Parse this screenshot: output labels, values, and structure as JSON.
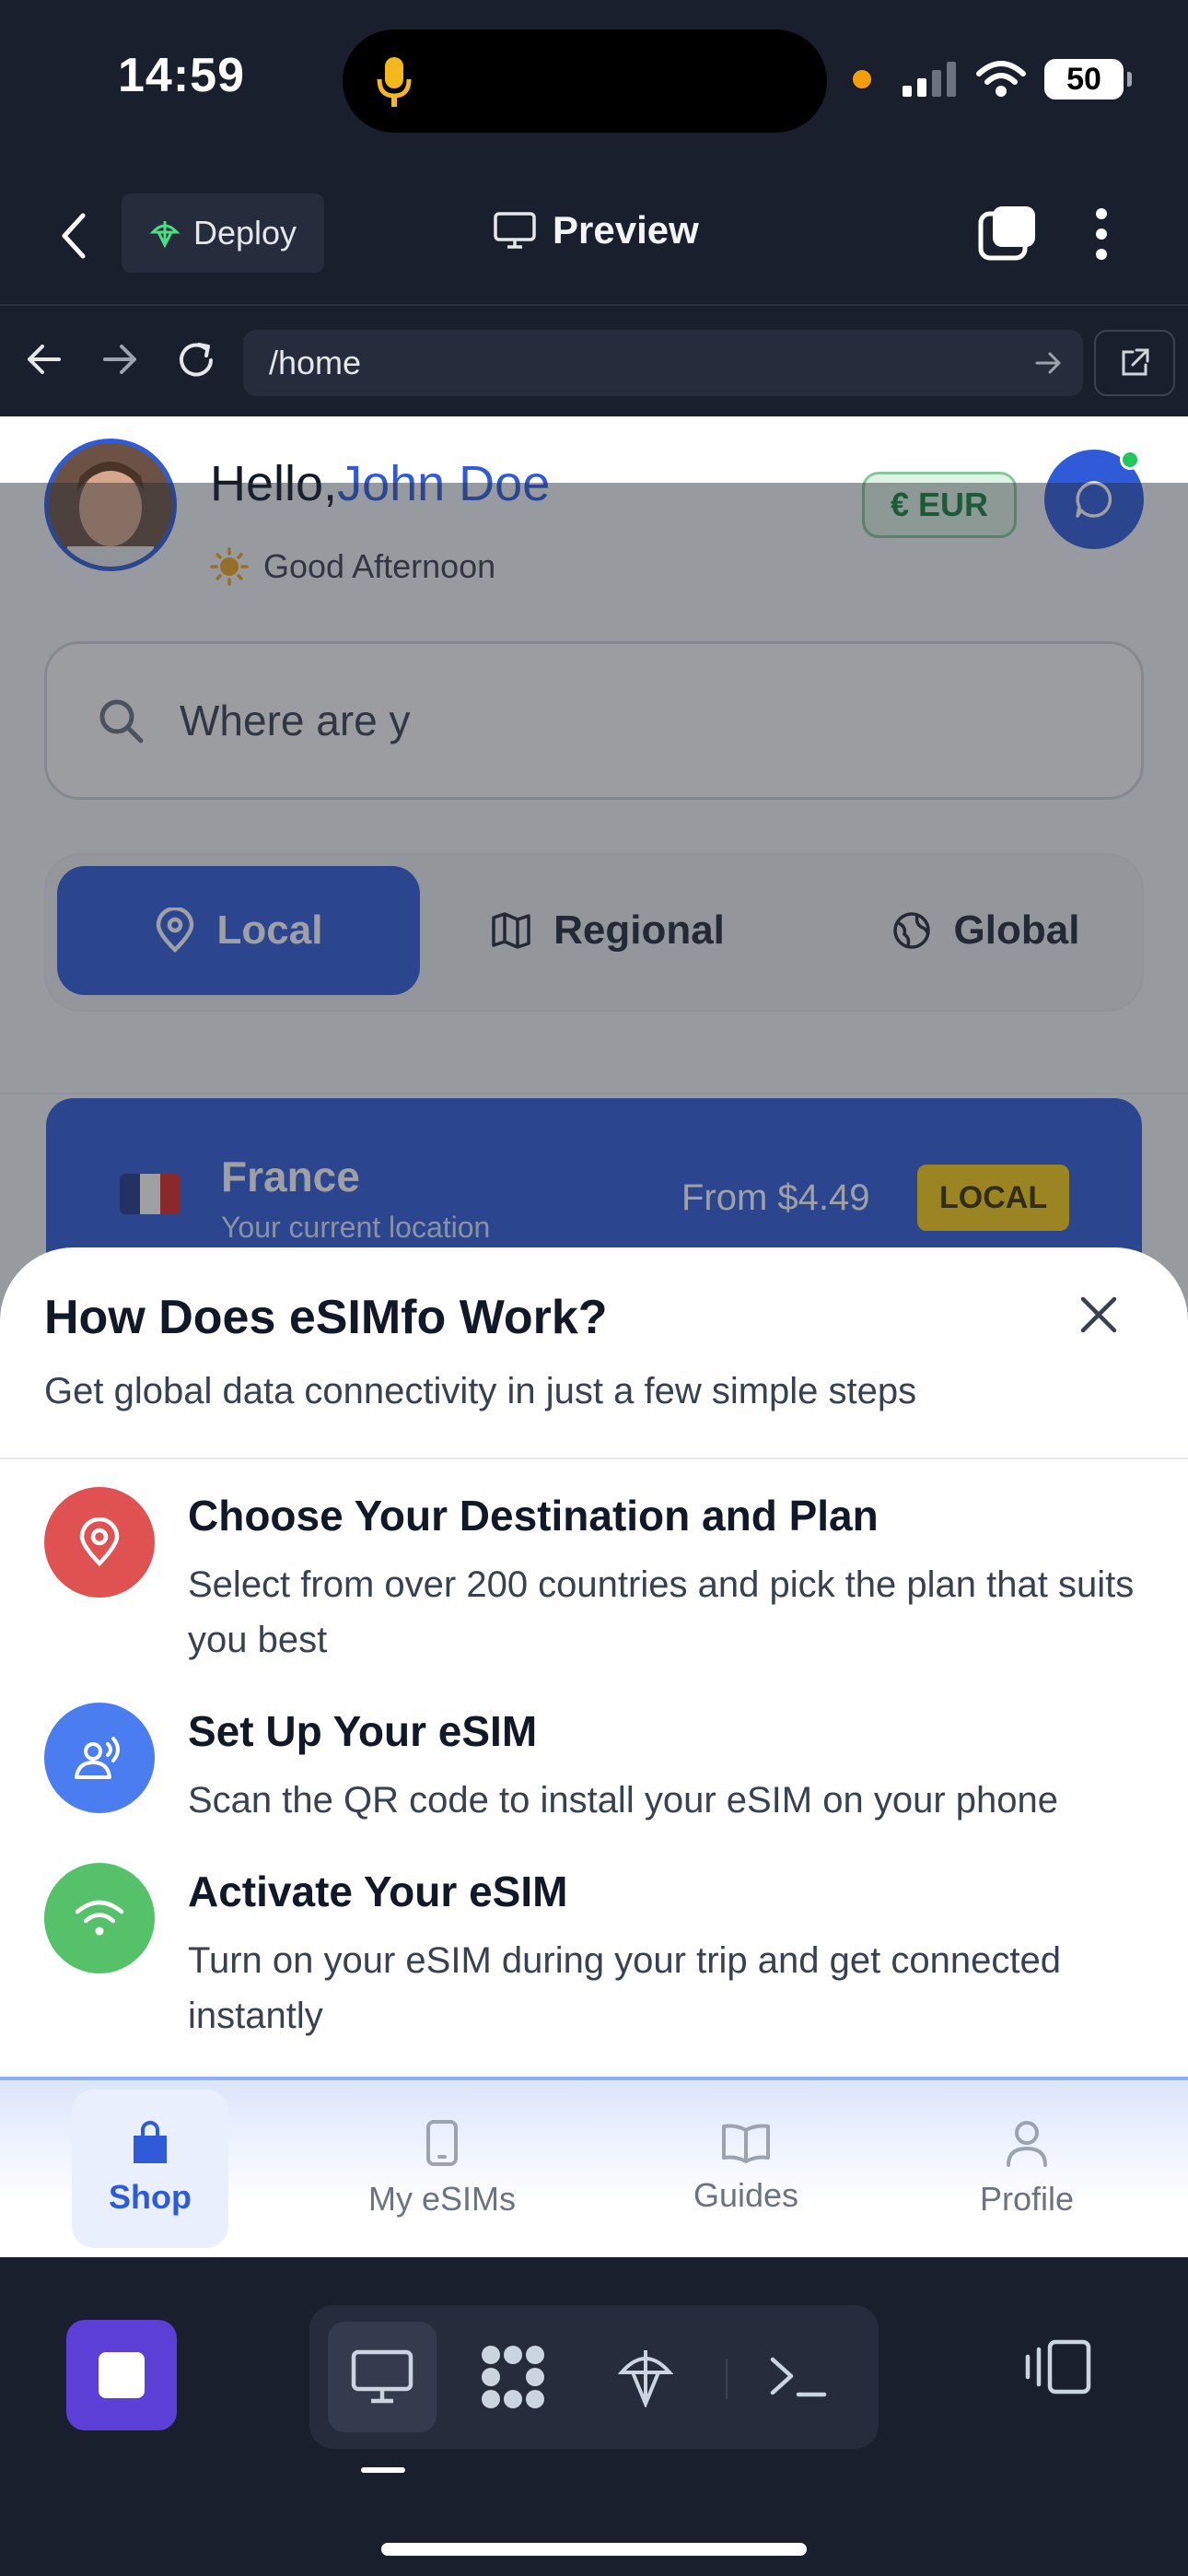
{
  "status": {
    "time": "14:59",
    "battery": "50"
  },
  "app_header": {
    "deploy_label": "Deploy",
    "preview_label": "Preview"
  },
  "browser": {
    "url": "/home"
  },
  "page": {
    "greeting_prefix": "Hello,",
    "user_name": "John Doe",
    "subgreeting": "Good Afternoon",
    "currency": "€ EUR",
    "search_placeholder": "Where are y",
    "segments": [
      "Local",
      "Regional",
      "Global"
    ],
    "country_card": {
      "name": "France",
      "subtitle": "Your current location",
      "price": "From $4.49",
      "badge": "LOCAL"
    }
  },
  "sheet": {
    "title": "How Does eSIMfo Work?",
    "subtitle": "Get global data connectivity in just a few simple steps",
    "steps": [
      {
        "title": "Choose Your Destination and Plan",
        "desc": "Select from over 200 countries and pick the plan that suits you best",
        "color": "#e05252"
      },
      {
        "title": "Set Up Your eSIM",
        "desc": "Scan the QR code to install your eSIM on your phone",
        "color": "#4a7ef0"
      },
      {
        "title": "Activate Your eSIM",
        "desc": "Turn on your eSIM during your trip and get connected instantly",
        "color": "#55c26a"
      }
    ]
  },
  "bottom_nav": [
    "Shop",
    "My eSIMs",
    "Guides",
    "Profile"
  ],
  "colors": {
    "accent": "#2f5bd9",
    "chrome": "#1a1f2e",
    "stop": "#5b3fd6"
  }
}
